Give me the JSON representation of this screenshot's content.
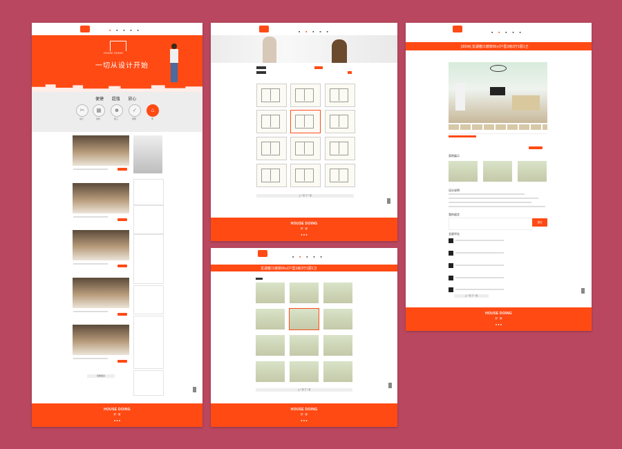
{
  "colors": {
    "background": "#b8475f",
    "accent": "#ff4a14",
    "panel": "#ffffff"
  },
  "home": {
    "logo_text": "HOUSE DOING",
    "hero_slogan": "一切从设计开始",
    "features": [
      "便捷",
      "超值",
      "放心"
    ],
    "steps": [
      {
        "icon": "tools-icon",
        "label": "设计"
      },
      {
        "icon": "grid-icon",
        "label": "选材"
      },
      {
        "icon": "worker-icon",
        "label": "施工"
      },
      {
        "icon": "shield-icon",
        "label": "保障"
      },
      {
        "icon": "house-icon",
        "label": "家"
      }
    ],
    "more_label": "查看更多"
  },
  "detail": {
    "title": "[300A] 龙湖春江彼岸90㎡户型3房2厅1厨1卫",
    "section_related": "案例展示",
    "section_design": "设计说明",
    "section_comments": "我的留言",
    "submit_label": "提交",
    "comments_label": "全部评论",
    "user_label": "小猪"
  },
  "gallery": {
    "title": "龙湖春江彼岸90㎡户型3房2厅1厨1卫",
    "pager": "上一页  下一页"
  },
  "footer": {
    "brand": "HOUSE DOING",
    "sub": "好 · 家"
  }
}
